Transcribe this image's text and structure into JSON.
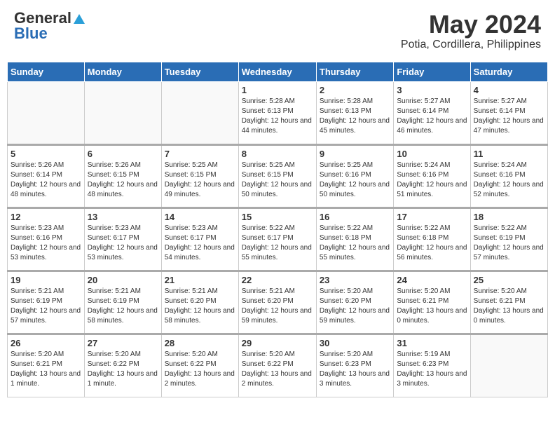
{
  "header": {
    "logo_general": "General",
    "logo_blue": "Blue",
    "title": "May 2024",
    "subtitle": "Potia, Cordillera, Philippines"
  },
  "days_of_week": [
    "Sunday",
    "Monday",
    "Tuesday",
    "Wednesday",
    "Thursday",
    "Friday",
    "Saturday"
  ],
  "weeks": [
    [
      {
        "day": null
      },
      {
        "day": null
      },
      {
        "day": null
      },
      {
        "day": "1",
        "sunrise": "5:28 AM",
        "sunset": "6:13 PM",
        "daylight": "12 hours and 44 minutes."
      },
      {
        "day": "2",
        "sunrise": "5:28 AM",
        "sunset": "6:13 PM",
        "daylight": "12 hours and 45 minutes."
      },
      {
        "day": "3",
        "sunrise": "5:27 AM",
        "sunset": "6:14 PM",
        "daylight": "12 hours and 46 minutes."
      },
      {
        "day": "4",
        "sunrise": "5:27 AM",
        "sunset": "6:14 PM",
        "daylight": "12 hours and 47 minutes."
      }
    ],
    [
      {
        "day": "5",
        "sunrise": "5:26 AM",
        "sunset": "6:14 PM",
        "daylight": "12 hours and 48 minutes."
      },
      {
        "day": "6",
        "sunrise": "5:26 AM",
        "sunset": "6:15 PM",
        "daylight": "12 hours and 48 minutes."
      },
      {
        "day": "7",
        "sunrise": "5:25 AM",
        "sunset": "6:15 PM",
        "daylight": "12 hours and 49 minutes."
      },
      {
        "day": "8",
        "sunrise": "5:25 AM",
        "sunset": "6:15 PM",
        "daylight": "12 hours and 50 minutes."
      },
      {
        "day": "9",
        "sunrise": "5:25 AM",
        "sunset": "6:16 PM",
        "daylight": "12 hours and 50 minutes."
      },
      {
        "day": "10",
        "sunrise": "5:24 AM",
        "sunset": "6:16 PM",
        "daylight": "12 hours and 51 minutes."
      },
      {
        "day": "11",
        "sunrise": "5:24 AM",
        "sunset": "6:16 PM",
        "daylight": "12 hours and 52 minutes."
      }
    ],
    [
      {
        "day": "12",
        "sunrise": "5:23 AM",
        "sunset": "6:16 PM",
        "daylight": "12 hours and 53 minutes."
      },
      {
        "day": "13",
        "sunrise": "5:23 AM",
        "sunset": "6:17 PM",
        "daylight": "12 hours and 53 minutes."
      },
      {
        "day": "14",
        "sunrise": "5:23 AM",
        "sunset": "6:17 PM",
        "daylight": "12 hours and 54 minutes."
      },
      {
        "day": "15",
        "sunrise": "5:22 AM",
        "sunset": "6:17 PM",
        "daylight": "12 hours and 55 minutes."
      },
      {
        "day": "16",
        "sunrise": "5:22 AM",
        "sunset": "6:18 PM",
        "daylight": "12 hours and 55 minutes."
      },
      {
        "day": "17",
        "sunrise": "5:22 AM",
        "sunset": "6:18 PM",
        "daylight": "12 hours and 56 minutes."
      },
      {
        "day": "18",
        "sunrise": "5:22 AM",
        "sunset": "6:19 PM",
        "daylight": "12 hours and 57 minutes."
      }
    ],
    [
      {
        "day": "19",
        "sunrise": "5:21 AM",
        "sunset": "6:19 PM",
        "daylight": "12 hours and 57 minutes."
      },
      {
        "day": "20",
        "sunrise": "5:21 AM",
        "sunset": "6:19 PM",
        "daylight": "12 hours and 58 minutes."
      },
      {
        "day": "21",
        "sunrise": "5:21 AM",
        "sunset": "6:20 PM",
        "daylight": "12 hours and 58 minutes."
      },
      {
        "day": "22",
        "sunrise": "5:21 AM",
        "sunset": "6:20 PM",
        "daylight": "12 hours and 59 minutes."
      },
      {
        "day": "23",
        "sunrise": "5:20 AM",
        "sunset": "6:20 PM",
        "daylight": "12 hours and 59 minutes."
      },
      {
        "day": "24",
        "sunrise": "5:20 AM",
        "sunset": "6:21 PM",
        "daylight": "13 hours and 0 minutes."
      },
      {
        "day": "25",
        "sunrise": "5:20 AM",
        "sunset": "6:21 PM",
        "daylight": "13 hours and 0 minutes."
      }
    ],
    [
      {
        "day": "26",
        "sunrise": "5:20 AM",
        "sunset": "6:21 PM",
        "daylight": "13 hours and 1 minute."
      },
      {
        "day": "27",
        "sunrise": "5:20 AM",
        "sunset": "6:22 PM",
        "daylight": "13 hours and 1 minute."
      },
      {
        "day": "28",
        "sunrise": "5:20 AM",
        "sunset": "6:22 PM",
        "daylight": "13 hours and 2 minutes."
      },
      {
        "day": "29",
        "sunrise": "5:20 AM",
        "sunset": "6:22 PM",
        "daylight": "13 hours and 2 minutes."
      },
      {
        "day": "30",
        "sunrise": "5:20 AM",
        "sunset": "6:23 PM",
        "daylight": "13 hours and 3 minutes."
      },
      {
        "day": "31",
        "sunrise": "5:19 AM",
        "sunset": "6:23 PM",
        "daylight": "13 hours and 3 minutes."
      },
      {
        "day": null
      }
    ]
  ]
}
